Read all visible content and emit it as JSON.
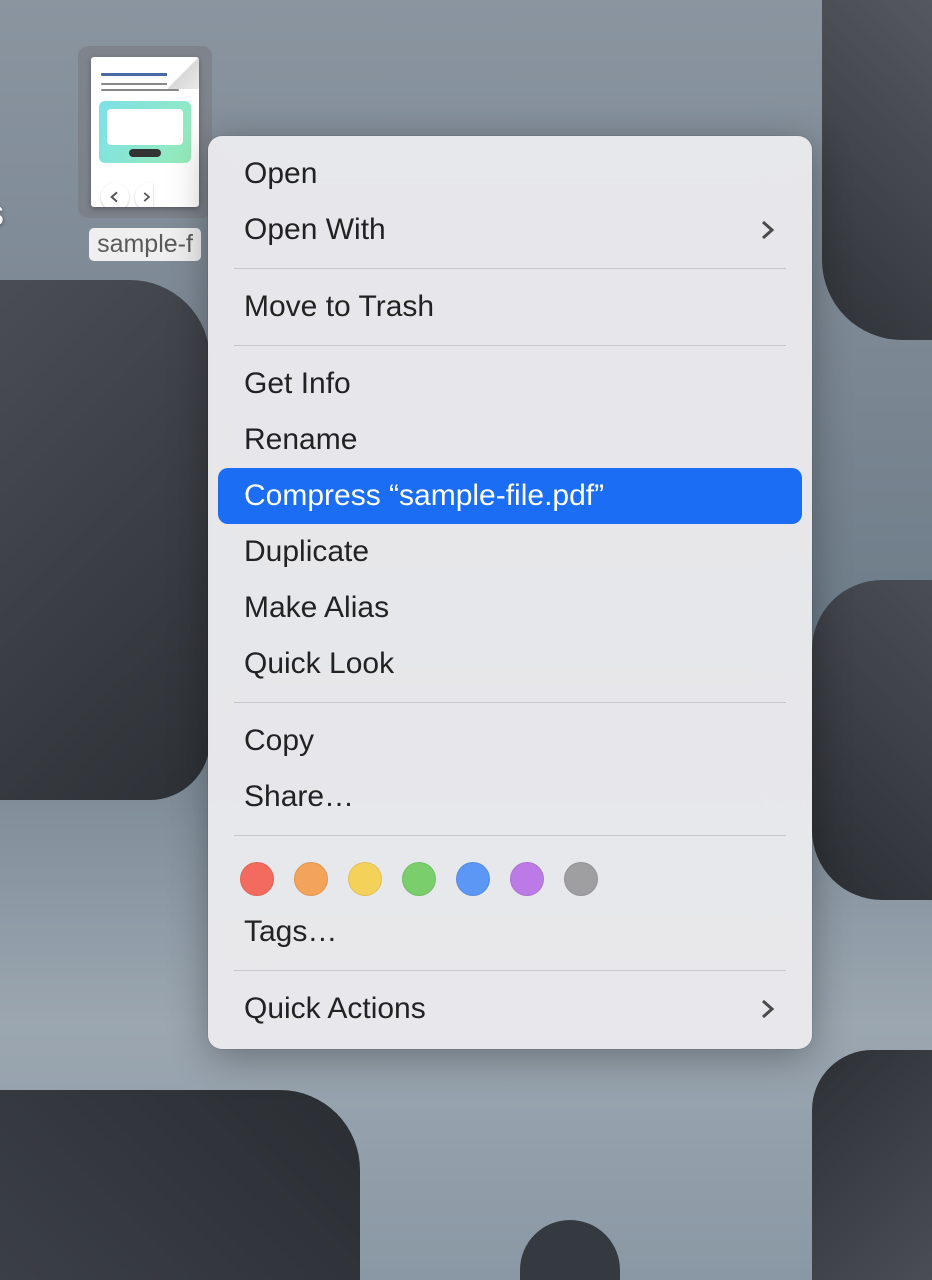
{
  "desktop": {
    "file_label": "sample-f",
    "edge_glyph": "s"
  },
  "context_menu": {
    "open": "Open",
    "open_with": "Open With",
    "move_to_trash": "Move to Trash",
    "get_info": "Get Info",
    "rename": "Rename",
    "compress": "Compress “sample-file.pdf”",
    "duplicate": "Duplicate",
    "make_alias": "Make Alias",
    "quick_look": "Quick Look",
    "copy": "Copy",
    "share": "Share…",
    "tags": "Tags…",
    "quick_actions": "Quick Actions"
  },
  "tag_colors": {
    "red": "#f36b5f",
    "orange": "#f3a35a",
    "yellow": "#f4d159",
    "green": "#7ace6b",
    "blue": "#5c97f5",
    "purple": "#bb7ae6",
    "gray": "#9f9fa2"
  }
}
